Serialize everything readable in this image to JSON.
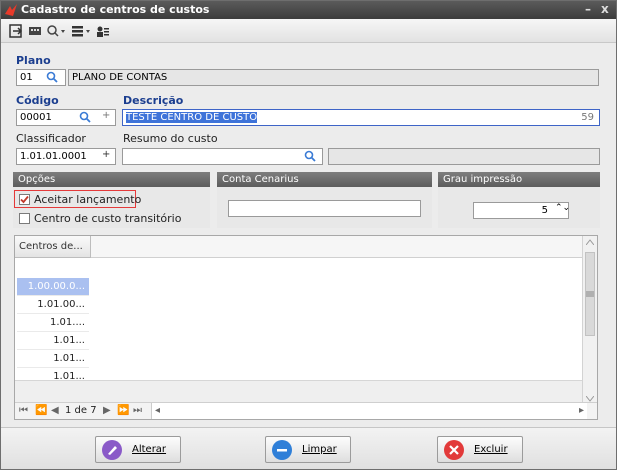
{
  "window": {
    "title": "Cadastro de centros de custos",
    "minimize": "–",
    "close": "x"
  },
  "plano": {
    "label": "Plano",
    "code": "01",
    "name": "PLANO DE CONTAS"
  },
  "codigo": {
    "label": "Código",
    "value": "00001",
    "plus": "+"
  },
  "descricao": {
    "label": "Descrição",
    "value": "TESTE CENTRO DE CUSTO",
    "count": "59"
  },
  "classificador": {
    "label": "Classificador",
    "value": "1.01.01.0001",
    "plus": "+"
  },
  "resumo": {
    "label": "Resumo do custo",
    "value": ""
  },
  "opcoes": {
    "title": "Opções",
    "aceitar": "Aceitar lançamento",
    "transitorio": "Centro de custo transitório"
  },
  "conta_cenarius": {
    "title": "Conta Cenarius",
    "value": ""
  },
  "grau": {
    "title": "Grau impressão",
    "value": "5",
    "spin": "⌃⌄"
  },
  "grid": {
    "header": "Centros de...",
    "rows": [
      "1.00.00.0...",
      "1.01.00...",
      "1.01....",
      "1.01...",
      "1.01...",
      "1.01..."
    ]
  },
  "pager": {
    "first": "⏮",
    "prev_page": "⏪",
    "prev": "◀",
    "text": "1 de 7",
    "next": "▶",
    "next_page": "⏩",
    "last": "⏭",
    "left": "◂",
    "right": "▸"
  },
  "buttons": {
    "alterar": "Alterar",
    "limpar": "Limpar",
    "excluir": "Excluir"
  },
  "colors": {
    "accent": "#1b3e8f",
    "selection": "#3e73d9",
    "highlight_box": "#e53a3a"
  }
}
